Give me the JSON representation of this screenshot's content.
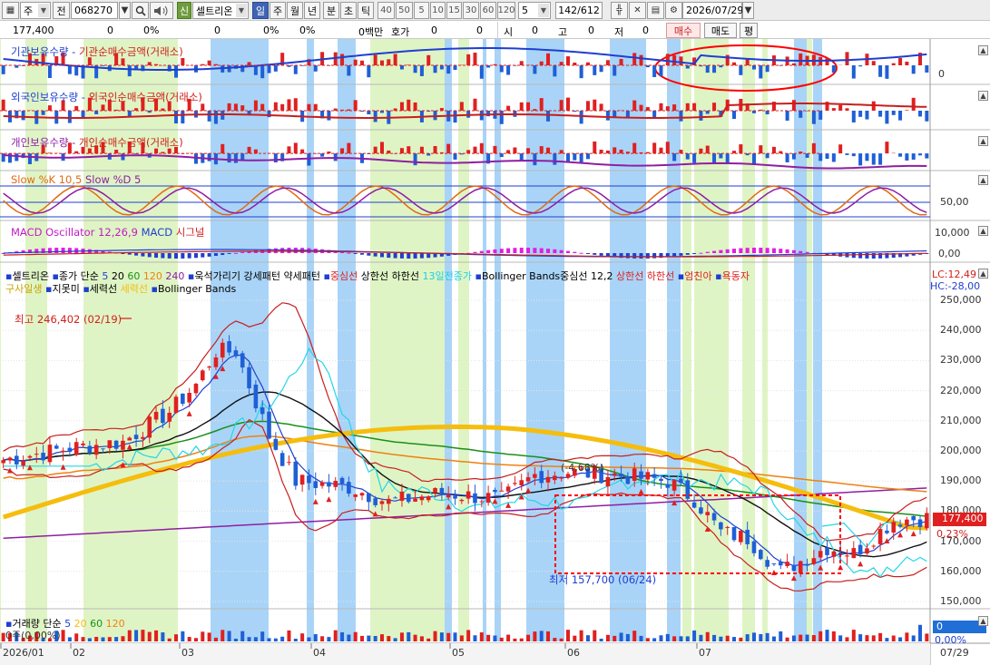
{
  "toolbar": {
    "market_select": "주",
    "prev_button": "전",
    "code": "068270",
    "stock_name": "셀트리온",
    "new_tag": "신",
    "period_tabs": [
      "일",
      "주",
      "월",
      "년",
      "분",
      "초",
      "틱"
    ],
    "active_period": "일",
    "intervals": [
      "40",
      "50",
      "5",
      "10",
      "15",
      "30",
      "60",
      "120"
    ],
    "interval_value": "5",
    "bar_count": "142/612",
    "date": "2026/07/29"
  },
  "quote": {
    "price": "177,400",
    "change": "0",
    "change_pct": "0%",
    "volume": "0",
    "volume_pct": "0%",
    "amount": "0백만",
    "hoga_label": "호가",
    "hoga_bid": "0",
    "hoga_ask": "0",
    "open_label": "시",
    "open_value": "0",
    "high_label": "고",
    "high_value": "0",
    "low_label": "저",
    "low_value": "0",
    "buy_button": "매수",
    "sell_button": "매도",
    "avg_button": "평"
  },
  "panels": {
    "inst": {
      "l1": "기관보유수량",
      "l2": "기관순매수금액(거래소)",
      "zero": "0"
    },
    "foreign": {
      "l1": "외국인보유수량",
      "l2": "외국인순매수금액(거래소)"
    },
    "indiv": {
      "l1": "개인보유수량",
      "l2": "개인순매수금액(거래소)"
    },
    "slow": {
      "l1": "Slow %K 10,5",
      "l2": "Slow %D 5",
      "y50": "50,00"
    },
    "macd": {
      "l1": "MACD Oscillator 12,26,9",
      "l2": "MACD",
      "l3": "시그널",
      "y1": "10,000",
      "y0": "0,00"
    },
    "price_legend": {
      "name": "셀트리온",
      "ma": "종가 단순",
      "m5": "5",
      "m20": "20",
      "m60": "60",
      "m120": "120",
      "m240": "240",
      "p1": "욱석가리기",
      "p2": "강세패턴",
      "p3": "약세패턴",
      "p4": "중심선",
      "p5": "상한선",
      "p6": "하한선",
      "p7": "13일전종가",
      "p8": "Bollinger Bands중심선 12,2",
      "p9": "상한선",
      "p10": "하한선",
      "p11": "엄친아",
      "p12": "욕동자",
      "r2a": "구사일생",
      "r2b": "지못미",
      "r2c": "세력선",
      "r2d": "세력선",
      "r2e": "Bollinger Bands"
    },
    "lc": "LC:12,49",
    "hc": "HC:-28,00",
    "price_tag": "177,400",
    "pct_tag": "0,23%",
    "high_note": "최고 246,402 (02/19)",
    "low_note": "최저 157,700 (06/24)",
    "change_note": "(-4,68%)",
    "volume": {
      "l1": "거래량",
      "l2": "단순",
      "v5": "5",
      "v20": "20",
      "v60": "60",
      "v120": "120",
      "sub": "0주(0,00%)",
      "tag0": "0",
      "pct0": "0,00%"
    }
  },
  "y_axis": [
    "250,000",
    "240,000",
    "230,000",
    "220,000",
    "210,000",
    "200,000",
    "190,000",
    "180,000",
    "170,000",
    "160,000",
    "150,000"
  ],
  "x_axis": [
    "2026/01",
    "02",
    "03",
    "04",
    "05",
    "06",
    "07"
  ],
  "x_axis_right": "07/29",
  "colors": {
    "up": "#e02020",
    "down": "#1f5fd6",
    "accent_yellow": "#f5bd0d",
    "annotation_red": "#ff0000"
  },
  "icons": [
    "search-icon",
    "speaker-icon",
    "grid-icon",
    "crosshair-icon",
    "save-icon",
    "gear-icon"
  ]
}
